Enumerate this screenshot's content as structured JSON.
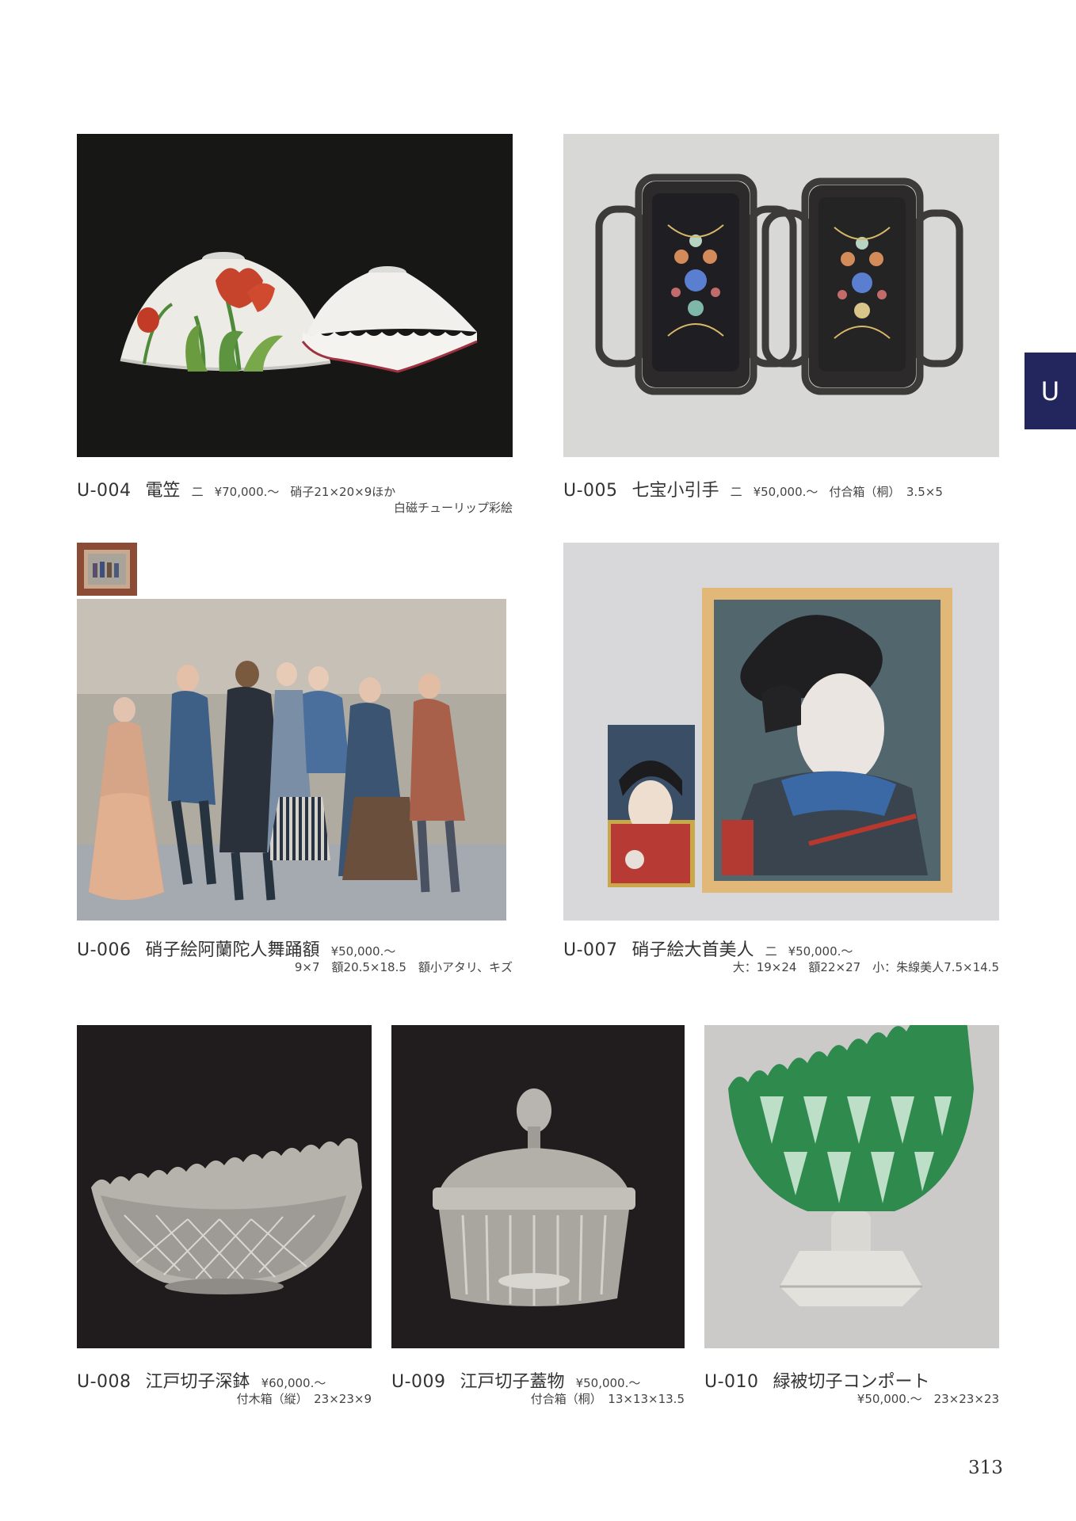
{
  "side_tab": "U",
  "page_number": "313",
  "items": [
    {
      "code": "U-004",
      "name": "電笠",
      "mark": "二",
      "price": "¥70,000.〜",
      "detail1": "硝子21×20×9ほか",
      "detail2": "白磁チューリップ彩絵"
    },
    {
      "code": "U-005",
      "name": "七宝小引手",
      "mark": "二",
      "price": "¥50,000.〜",
      "detail1": "付合箱（桐）　3.5×5"
    },
    {
      "code": "U-006",
      "name": "硝子絵阿蘭陀人舞踊額",
      "price": "¥50,000.〜",
      "detail2": "9×7　額20.5×18.5　額小アタリ、キズ"
    },
    {
      "code": "U-007",
      "name": "硝子絵大首美人",
      "mark": "二",
      "price": "¥50,000.〜",
      "detail2": "大：19×24　額22×27　小：朱線美人7.5×14.5"
    },
    {
      "code": "U-008",
      "name": "江戸切子深鉢",
      "price": "¥60,000.〜",
      "detail2": "付木箱（縦）　23×23×9"
    },
    {
      "code": "U-009",
      "name": "江戸切子蓋物",
      "price": "¥50,000.〜",
      "detail2": "付合箱（桐）　13×13×13.5"
    },
    {
      "code": "U-010",
      "name": "緑被切子コンポート",
      "detail2": "¥50,000.〜　23×23×23"
    }
  ]
}
